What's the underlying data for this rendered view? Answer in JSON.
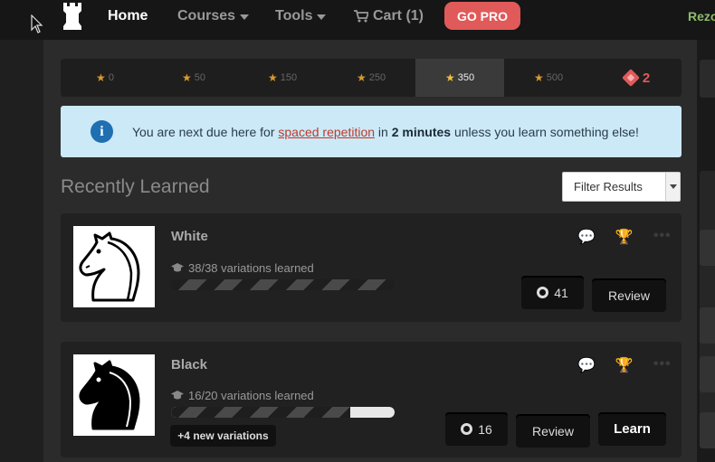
{
  "nav": {
    "home": "Home",
    "courses": "Courses",
    "tools": "Tools",
    "cart": "Cart (1)",
    "go_pro": "GO PRO",
    "user": "Rezo"
  },
  "points": [
    {
      "value": "0",
      "active": false
    },
    {
      "value": "50",
      "active": false
    },
    {
      "value": "150",
      "active": false
    },
    {
      "value": "250",
      "active": false
    },
    {
      "value": "350",
      "active": true
    },
    {
      "value": "500",
      "active": false
    }
  ],
  "gems": "2",
  "banner": {
    "pre": "You are next due here for",
    "link": "spaced repetition",
    "mid": "in",
    "time": "2 minutes",
    "post": "unless you learn something else!"
  },
  "heading": "Recently Learned",
  "filter": "Filter Results",
  "cards": [
    {
      "title": "White",
      "progress_text": "38/38 variations learned",
      "progress": 1.0,
      "count": "41",
      "review": "Review"
    },
    {
      "title": "Black",
      "progress_text": "16/20 variations learned",
      "progress": 0.8,
      "count": "16",
      "review": "Review",
      "learn": "Learn",
      "new_variations": "+4 new variations"
    }
  ],
  "colors": {
    "accent_pro": "#e05a5a",
    "banner_bg": "#cce9f7",
    "info_icon": "#1f6fb2",
    "link": "#c0392b"
  }
}
